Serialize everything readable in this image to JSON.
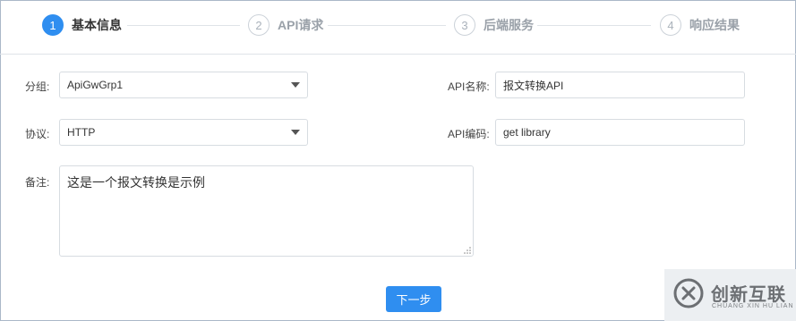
{
  "steps": [
    {
      "num": "1",
      "label": "基本信息"
    },
    {
      "num": "2",
      "label": "API请求"
    },
    {
      "num": "3",
      "label": "后端服务"
    },
    {
      "num": "4",
      "label": "响应结果"
    }
  ],
  "form": {
    "group_label": "分组:",
    "group_value": "ApiGwGrp1",
    "protocol_label": "协议:",
    "protocol_value": "HTTP",
    "api_name_label": "API名称:",
    "api_name_value": "报文转换API",
    "api_code_label": "API编码:",
    "api_code_value": "get library",
    "remark_label": "备注:",
    "remark_value": "这是一个报文转换是示例"
  },
  "next_button": "下一步",
  "watermark": {
    "cn": "创新互联",
    "en": "CHUANG XIN HU LIAN"
  },
  "colors": {
    "accent": "#2f8ef0"
  }
}
